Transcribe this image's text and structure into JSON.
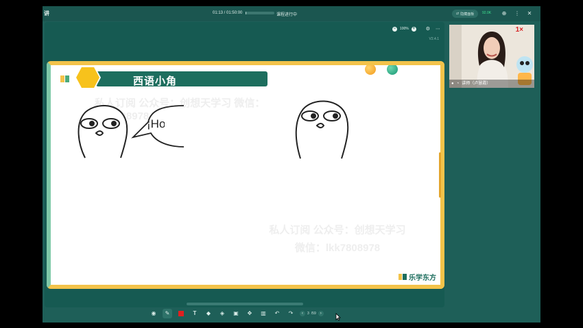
{
  "app": {
    "title": "讲"
  },
  "topbar": {
    "elapsed": "01:13",
    "duration": "01:50:00",
    "progress": 0.011,
    "status": "课程进行中",
    "hide_panel_label": "隐藏面板",
    "network": "92.0K"
  },
  "board": {
    "zoom": "100%",
    "version": "V2.4.1"
  },
  "slide": {
    "title": "西语小角",
    "speech": "¡Hola!",
    "watermark_top": "私人订阅 公众号：创想天学习 微信：lkk7808978",
    "watermark_bottom_1": "私人订阅 公众号：创想天学习",
    "watermark_bottom_2": "微信：lkk7808978",
    "brand": "乐学东方"
  },
  "pager": {
    "current": "3",
    "total": "/59"
  },
  "video": {
    "teacher_name": "讲师（卢慧霞）",
    "rate": "1×"
  },
  "colors": {
    "app_bg": "#1e5f58",
    "slide_border_top": "#f3c34a",
    "title_bar": "#1d6e5e",
    "accent_green": "#7fc9a8"
  },
  "icons": {
    "toolbar": [
      "record-icon",
      "pen-icon",
      "color-swatch-icon",
      "text-icon",
      "shape-icon",
      "eraser-icon",
      "fill-icon",
      "move-icon",
      "delete-icon",
      "undo-icon",
      "redo-icon"
    ]
  }
}
